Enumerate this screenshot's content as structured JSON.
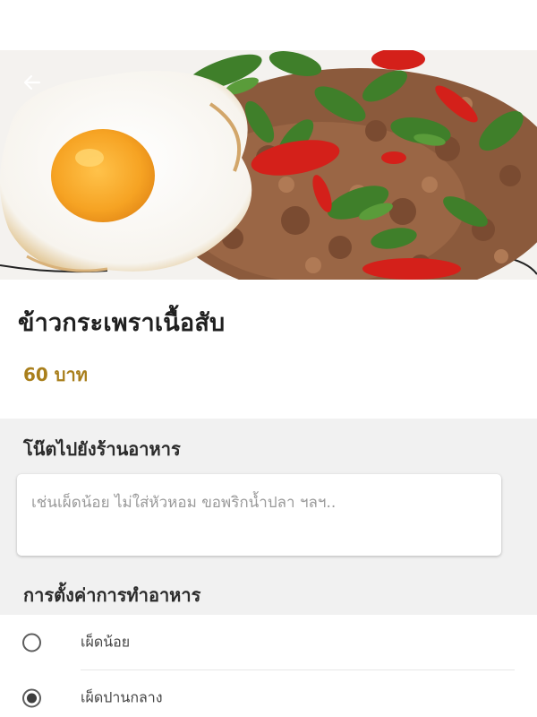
{
  "item": {
    "name": "ข้าวกระเพราเนื้อสับ",
    "price": "60 บาท"
  },
  "note": {
    "heading": "โน๊ตไปยังร้านอาหาร",
    "placeholder": "เช่นเผ็ดน้อย ไม่ใส่หัวหอม ขอพริกน้ำปลา ฯลฯ..",
    "value": ""
  },
  "cooking": {
    "heading": "การตั้งค่าการทำอาหาร",
    "options": [
      {
        "label": "เผ็ดน้อย",
        "selected": false
      },
      {
        "label": "เผ็ดปานกลาง",
        "selected": true
      }
    ]
  },
  "icons": {
    "back": "arrow-left-icon"
  },
  "colors": {
    "price": "#a97f1c",
    "section_bg": "#f1f1f1"
  }
}
